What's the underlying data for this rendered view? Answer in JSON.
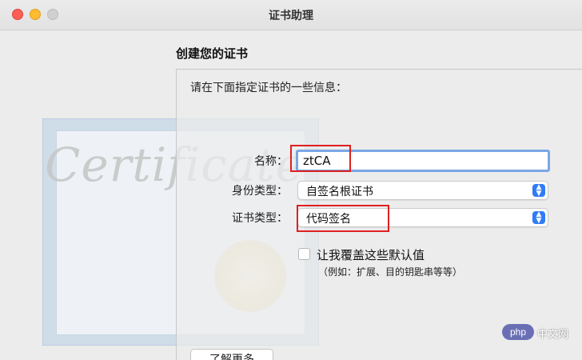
{
  "window": {
    "title": "证书助理"
  },
  "page": {
    "heading": "创建您的证书",
    "instruction": "请在下面指定证书的一些信息："
  },
  "background_art": {
    "script_text": "Certificate"
  },
  "form": {
    "name_label": "名称：",
    "name_value": "ztCA",
    "identity_type_label": "身份类型：",
    "identity_type_value": "自签名根证书",
    "cert_type_label": "证书类型：",
    "cert_type_value": "代码签名",
    "override_label": "让我覆盖这些默认值",
    "override_hint": "（例如：扩展、目的钥匙串等等）",
    "override_checked": false
  },
  "buttons": {
    "learn_more": "了解更多"
  },
  "watermark": {
    "badge": "php",
    "text": "中文网"
  },
  "icons": {
    "select_stepper": "up-down-chevron-icon"
  },
  "colors": {
    "highlight_box": "#e02020",
    "focus_ring": "#7aa7e6",
    "stepper": "#2f7cf6"
  }
}
